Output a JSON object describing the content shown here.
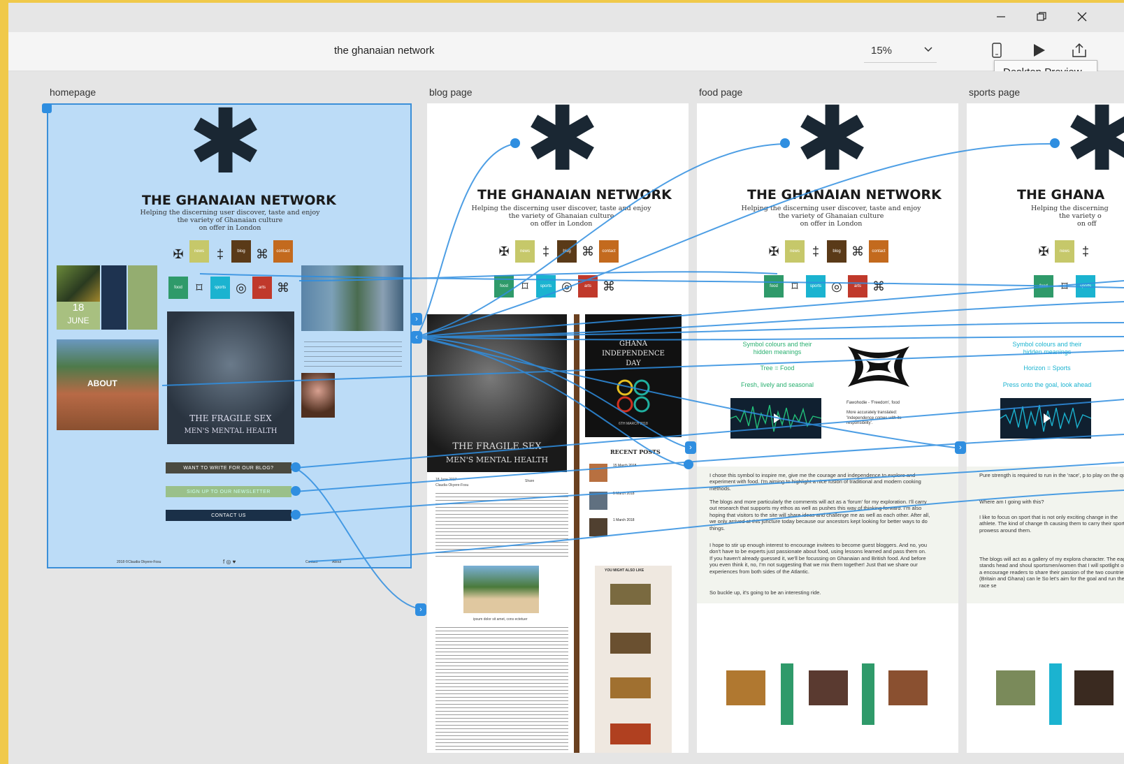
{
  "window": {
    "minimize_icon": "minimize-icon",
    "maximize_icon": "restore-icon",
    "close_icon": "close-icon"
  },
  "toolbar": {
    "document_title": "the ghanaian network",
    "zoom_value": "15%",
    "device_icon": "mobile-device-icon",
    "play_icon": "play-icon",
    "share_icon": "share-icon",
    "tooltip": "Desktop Preview"
  },
  "artboards": [
    {
      "label": "homepage"
    },
    {
      "label": "blog page"
    },
    {
      "label": "food page"
    },
    {
      "label": "sports page"
    }
  ],
  "site": {
    "title": "THE GHANAIAN NETWORK",
    "title_cropped": "THE GHANA",
    "tagline_1": "Helping the discerning user discover, taste and enjoy",
    "tagline_2": "the variety of Ghanaian culture",
    "tagline_3": "on offer in London",
    "tagline_1_cropped": "Helping the discerning",
    "tagline_2_cropped": "the variety o",
    "tagline_3_cropped": "on off",
    "tiles": [
      "news",
      "blog",
      "contact",
      "food",
      "sports",
      "arts"
    ],
    "tile_colors": {
      "news": "#c6c86a",
      "blog": "#5a3a18",
      "contact": "#c36a1e",
      "food": "#2f9a6a",
      "sports": "#1bb3d0",
      "arts": "#c0392b"
    }
  },
  "homepage": {
    "date_day": "18",
    "date_month": "JUNE",
    "about_label": "ABOUT",
    "feature_line1": "THE FRAGILE SEX",
    "feature_line2": "MEN'S MENTAL HEALTH",
    "btn_write": "WANT TO WRITE FOR OUR BLOG?",
    "btn_newsletter": "SIGN UP TO OUR NEWSLETTER",
    "btn_contact": "CONTACT US",
    "footer_left": "2018 ©Claudia Okyere-Fosu",
    "footer_contact": "Contact",
    "footer_about": "About"
  },
  "blog": {
    "feature_line1": "THE FRAGILE SEX",
    "feature_line2": "MEN'S MENTAL HEALTH",
    "poster_line1": "GHANA",
    "poster_line2": "INDEPENDENCE",
    "poster_line3": "DAY",
    "poster_date": "6TH MARCH 2018",
    "recent_posts": "RECENT POSTS",
    "post1": "15 March 2018",
    "post2": "5 March 2018",
    "post3": "1 March 2018",
    "you_might": "YOU MIGHT ALSO LIKE",
    "date_line": "18 June 2017",
    "author_line": "Claudia Okyere-Fosu",
    "share": "Share",
    "caption": "ipsum dolor sit amet, cons ectetuer"
  },
  "food": {
    "sym_title1": "Symbol colours and their",
    "sym_title2": "hidden meanings",
    "line1": "Tree = Food",
    "line2": "Fresh, lively and seasonal",
    "symbol_caption": "Fawohodie - 'Freedom', food",
    "symbol_note": "More accurately translated: 'Independence comes with its responsibility'.",
    "para1": "I chose this symbol to inspire me, give me the courage and independence to explore and experiment with food. I'm aiming to highlight a nice fusion of traditional and modern cooking methods.",
    "para2": "The blogs and more particularly the comments will act as a 'forum' for my exploration. I'll carry out research that supports my ethos as well as pushes this way of thinking forward. I'm also hoping that visitors to the site will share ideas and challenge me as well as each other. After all, we only arrived at this juncture today because our ancestors kept looking for better ways to do things.",
    "para3": "I hope to stir up enough interest to encourage invitees to become guest bloggers. And no, you don't have to be experts just passionate about food, using lessons learned and pass them on. If you haven't already guessed it, we'll be focussing on Ghanaian and British food. And before you even think it, no, I'm not suggesting that we mix them together! Just that we share our experiences from both sides of the Atlantic.",
    "para4": "So buckle up, it's going to be an interesting ride."
  },
  "sports": {
    "sym_title1": "Symbol colours and their",
    "sym_title2": "hidden meanings",
    "line1": "Horizon = Sports",
    "line2": "Press onto the goal, look ahead",
    "para1": "Pure strength is required to run in the 'race', p to play on the qualities of this powerfully built b talons of eagles are strong sharp and designed",
    "para2": "Where am I going with this?",
    "para3": "I like to focus on sport that is not only exciting change in the athlete. The kind of change th causing them to carry their sporting prowess around them.",
    "para4": "The blogs will act as a gallery of my explora character. The eagle stands head and shoul sportsmen/women that I will spotlight once a encourage readers to share their passion of the two countries (Britain and Ghana) can le So let's aim for the goal and run the race se"
  }
}
